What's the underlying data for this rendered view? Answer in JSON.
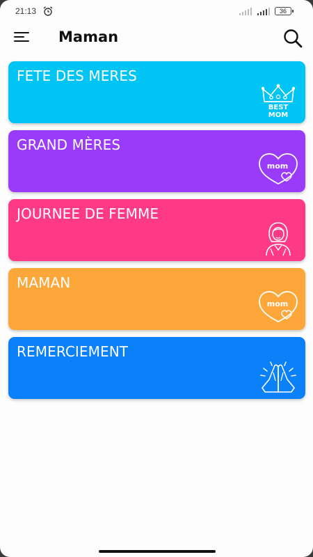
{
  "status_bar": {
    "time": "21:13",
    "battery": "36",
    "icons": [
      "alarm-icon",
      "signal-icon",
      "signal-icon",
      "battery-icon"
    ]
  },
  "header": {
    "title": "Maman",
    "menu_icon": "hamburger-menu-icon",
    "search_icon": "search-icon"
  },
  "categories": [
    {
      "label": "FETE DES MERES",
      "color": "#00C4F4",
      "icon": "best-mom-crown-icon",
      "icon_text": [
        "BEST",
        "MOM"
      ]
    },
    {
      "label": "GRAND MÈRES",
      "color": "#9A3BFA",
      "icon": "mom-heart-icon",
      "icon_text": [
        "mom"
      ]
    },
    {
      "label": "JOURNEE DE FEMME",
      "color": "#FE3A86",
      "icon": "woman-icon"
    },
    {
      "label": "MAMAN",
      "color": "#FDA73A",
      "icon": "mom-heart-icon",
      "icon_text": [
        "mom"
      ]
    },
    {
      "label": "REMERCIEMENT",
      "color": "#0A80F9",
      "icon": "praying-hands-icon"
    }
  ]
}
